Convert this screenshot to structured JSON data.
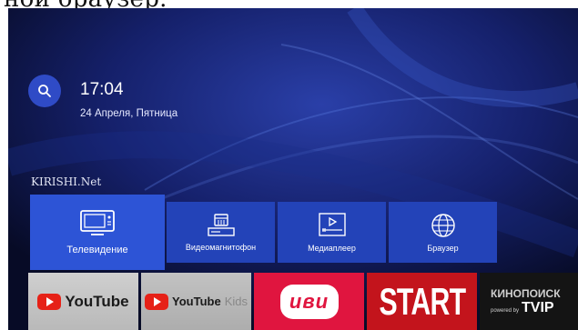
{
  "caption": "ной браузер.",
  "status": {
    "time": "17:04",
    "date": "24 Апреля, Пятница"
  },
  "provider": "KIRISHI.Net",
  "tiles": [
    {
      "label": "Телевидение",
      "icon": "tv-icon"
    },
    {
      "label": "Видеомагнитофон",
      "icon": "recorder-icon"
    },
    {
      "label": "Медиаплеер",
      "icon": "media-player-icon"
    },
    {
      "label": "Браузер",
      "icon": "globe-icon"
    }
  ],
  "apps": [
    {
      "name": "YouTube"
    },
    {
      "name": "YouTube",
      "suffix": "Kids"
    },
    {
      "name": "иви"
    },
    {
      "name": "START"
    },
    {
      "name_top": "КИНОПОИСК",
      "powered": "powered by",
      "brand": "TVIP"
    }
  ],
  "colors": {
    "accent": "#2d54d6",
    "tile": "#2343b8",
    "background": "#0a1033"
  }
}
